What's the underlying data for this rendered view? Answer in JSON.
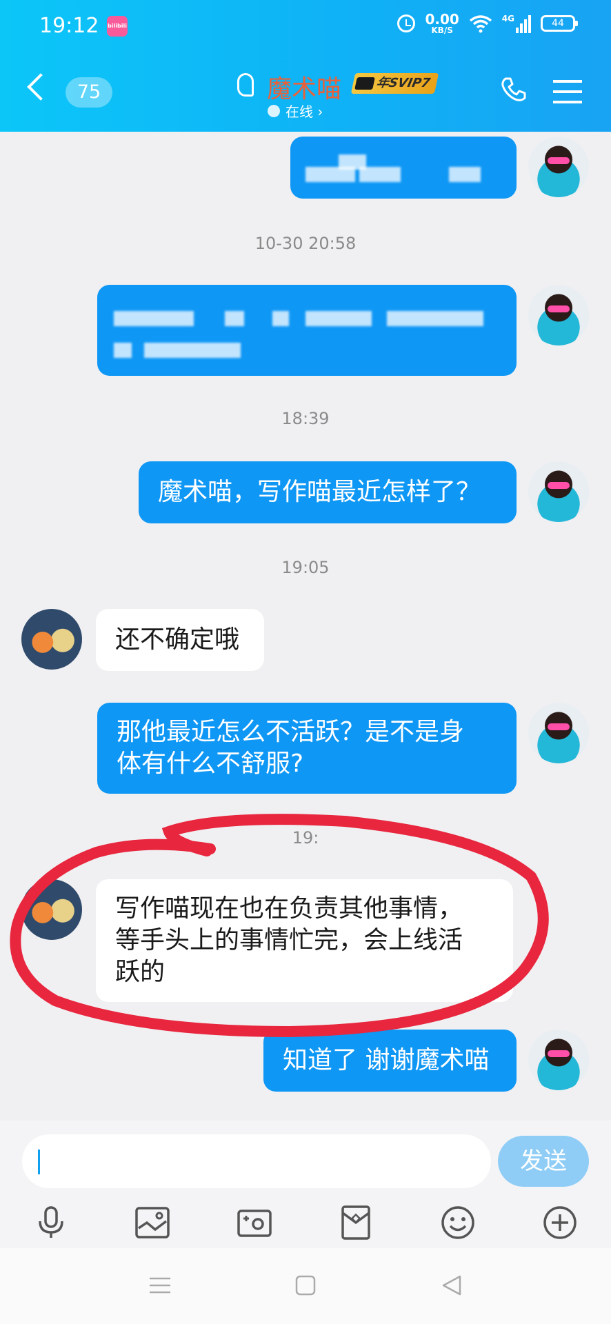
{
  "status_bar": {
    "time": "19:12",
    "app_icon_text": "bilibili",
    "net_speed_value": "0.00",
    "net_speed_unit": "KB/S",
    "network_type": "4G",
    "battery": "44"
  },
  "header": {
    "unread_count": "75",
    "contact_name": "魔术喵",
    "vip_badge": "年SVIP7",
    "online_status": "在线 ›",
    "background_color": "#10b4f6",
    "name_color": "#e8613a"
  },
  "timestamps": [
    "10-30 20:58",
    "18:39",
    "19:05",
    "19:"
  ],
  "messages": [
    {
      "id": "m1",
      "sender": "me",
      "text": "",
      "redacted": true
    },
    {
      "id": "m2",
      "sender": "me",
      "text": "",
      "redacted": true
    },
    {
      "id": "m3",
      "sender": "me",
      "text": "魔术喵，写作喵最近怎样了？"
    },
    {
      "id": "m4",
      "sender": "them",
      "text": "还不确定哦"
    },
    {
      "id": "m5",
      "sender": "me",
      "text": "那他最近怎么不活跃？是不是身\n体有什么不舒服?"
    },
    {
      "id": "m6",
      "sender": "them",
      "text": "写作喵现在也在负责其他事情，\n等手头上的事情忙完，会上线活\n跃的",
      "highlighted": true
    },
    {
      "id": "m7",
      "sender": "me",
      "text": "知道了 谢谢魔术喵"
    }
  ],
  "input": {
    "value": "",
    "send_label": "发送"
  },
  "toolbar_icons": [
    "microphone-icon",
    "image-icon",
    "camera-icon",
    "red-packet-icon",
    "emoji-icon",
    "plus-icon"
  ],
  "colors": {
    "bubble_out": "#0f97f5",
    "bubble_in": "#ffffff",
    "annotation": "#e8263e",
    "send_button": "#8fcdf6"
  }
}
